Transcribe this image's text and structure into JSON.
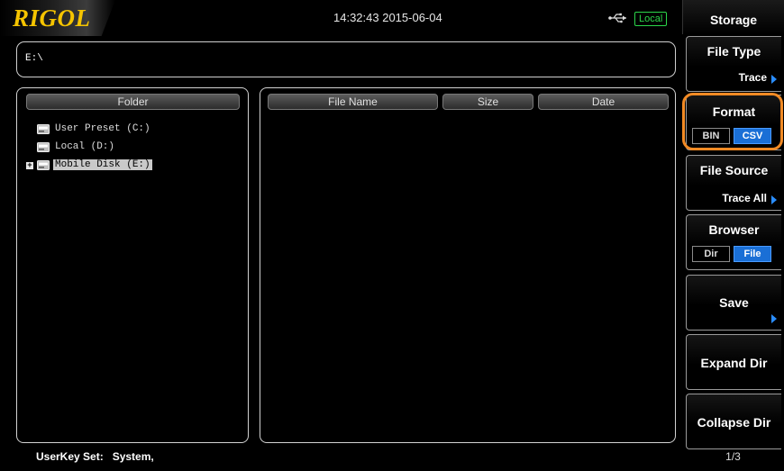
{
  "header": {
    "logo": "RIGOL",
    "datetime": "14:32:43 2015-06-04",
    "local_badge": "Local"
  },
  "path": {
    "current": "E:\\"
  },
  "folder_panel": {
    "header": "Folder",
    "items": [
      {
        "label": "User Preset (C:)",
        "expandable": false,
        "selected": false
      },
      {
        "label": "Local (D:)",
        "expandable": false,
        "selected": false
      },
      {
        "label": "Mobile Disk (E:)",
        "expandable": true,
        "selected": true
      }
    ]
  },
  "files_panel": {
    "headers": {
      "name": "File Name",
      "size": "Size",
      "date": "Date"
    }
  },
  "status": {
    "text": "UserKey Set:   System,"
  },
  "menu": {
    "title": "Storage",
    "file_type": {
      "label": "File Type",
      "value": "Trace"
    },
    "format": {
      "label": "Format",
      "options": [
        "BIN",
        "CSV"
      ],
      "selected": "CSV"
    },
    "file_source": {
      "label": "File Source",
      "value": "Trace All"
    },
    "browser": {
      "label": "Browser",
      "options": [
        "Dir",
        "File"
      ],
      "selected": "File"
    },
    "save": {
      "label": "Save"
    },
    "expand_dir": {
      "label": "Expand Dir"
    },
    "collapse_dir": {
      "label": "Collapse Dir"
    },
    "page": "1/3"
  },
  "colors": {
    "accent_blue": "#1a6fd6",
    "logo_yellow": "#f5c400",
    "local_green": "#2bd64a",
    "highlight_orange": "#f28a24"
  }
}
